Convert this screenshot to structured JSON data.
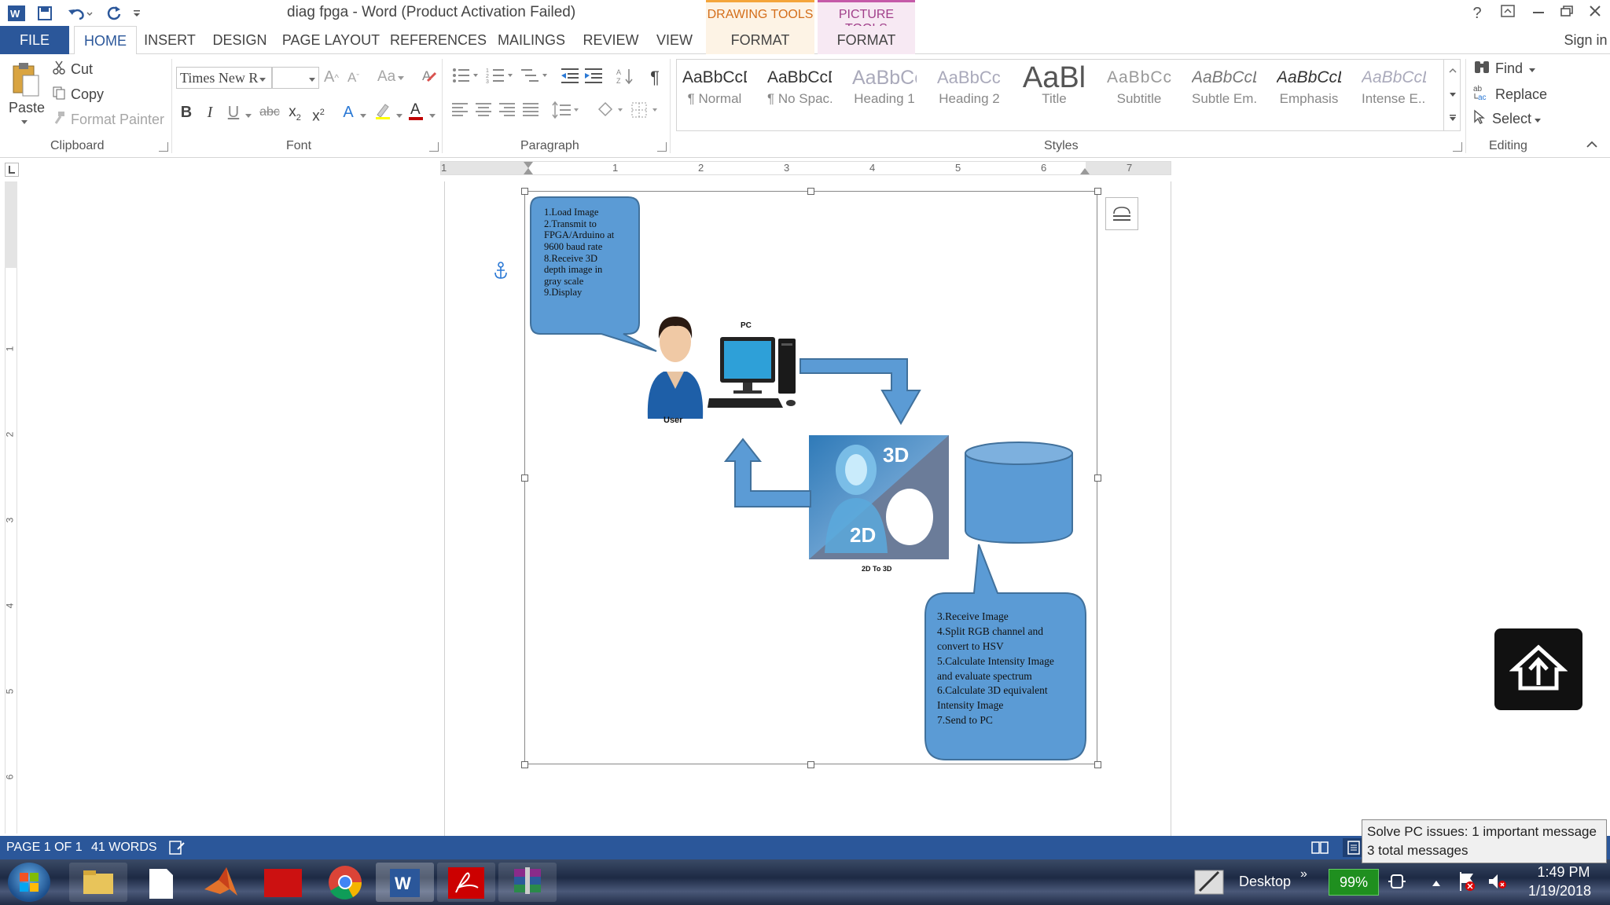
{
  "window": {
    "title": "diag fpga - Word (Product Activation Failed)",
    "context_groups": [
      "DRAWING TOOLS",
      "PICTURE TOOLS"
    ],
    "help": "?",
    "sign_in": "Sign in"
  },
  "tabs": {
    "file": "FILE",
    "items": [
      "HOME",
      "INSERT",
      "DESIGN",
      "PAGE LAYOUT",
      "REFERENCES",
      "MAILINGS",
      "REVIEW",
      "VIEW"
    ],
    "ctx_format_1": "FORMAT",
    "ctx_format_2": "FORMAT",
    "active": "HOME"
  },
  "ribbon": {
    "clipboard": {
      "paste": "Paste",
      "cut": "Cut",
      "copy": "Copy",
      "format_painter": "Format Painter",
      "label": "Clipboard"
    },
    "font": {
      "name": "Times New R",
      "size": "",
      "grow": "A",
      "shrink": "A",
      "change_case": "Aa",
      "label": "Font"
    },
    "paragraph": {
      "label": "Paragraph"
    },
    "styles": {
      "label": "Styles",
      "items": [
        {
          "preview": "AaBbCcDc",
          "name": "¶ Normal"
        },
        {
          "preview": "AaBbCcDc",
          "name": "¶ No Spac..."
        },
        {
          "preview": "AaBbCc",
          "name": "Heading 1"
        },
        {
          "preview": "AaBbCcD",
          "name": "Heading 2"
        },
        {
          "preview": "AaBl",
          "name": "Title"
        },
        {
          "preview": "AaBbCcD",
          "name": "Subtitle"
        },
        {
          "preview": "AaBbCcDa",
          "name": "Subtle Em..."
        },
        {
          "preview": "AaBbCcDa",
          "name": "Emphasis"
        },
        {
          "preview": "AaBbCcDa",
          "name": "Intense E..."
        }
      ]
    },
    "editing": {
      "find": "Find",
      "replace": "Replace",
      "select": "Select",
      "label": "Editing"
    }
  },
  "ruler": {
    "h_numbers": [
      "1",
      "1",
      "2",
      "3",
      "4",
      "5",
      "6",
      "7"
    ],
    "v_numbers": [
      "1",
      "2",
      "3",
      "4",
      "5",
      "6"
    ]
  },
  "diagram": {
    "bubble_user": "1.Load Image\n2.Transmit to\nFPGA/Arduino at\n9600 baud rate\n8.Receive 3D\ndepth image in\ngray scale\n9.Display",
    "bubble_fpga": "3.Receive Image\n4.Split RGB  channel and\nconvert to HSV\n5.Calculate Intensity Image\nand evaluate spectrum\n6.Calculate 3D equivalent\nIntensity Image\n7.Send to PC",
    "user_label": "User",
    "pc_label": "PC",
    "img_3d": "3D",
    "img_2d": "2D",
    "img_caption": "2D To 3D",
    "colors": {
      "shape_fill": "#5b9bd5",
      "shape_stroke": "#41719c"
    }
  },
  "status": {
    "page": "PAGE 1 OF 1",
    "words": "41 WORDS"
  },
  "taskbar": {
    "desktop": "Desktop",
    "battery": "99%",
    "time": "1:49 PM",
    "date": "1/19/2018"
  },
  "notification": {
    "line1": "Solve PC issues: 1 important message",
    "line2": "3 total messages"
  }
}
